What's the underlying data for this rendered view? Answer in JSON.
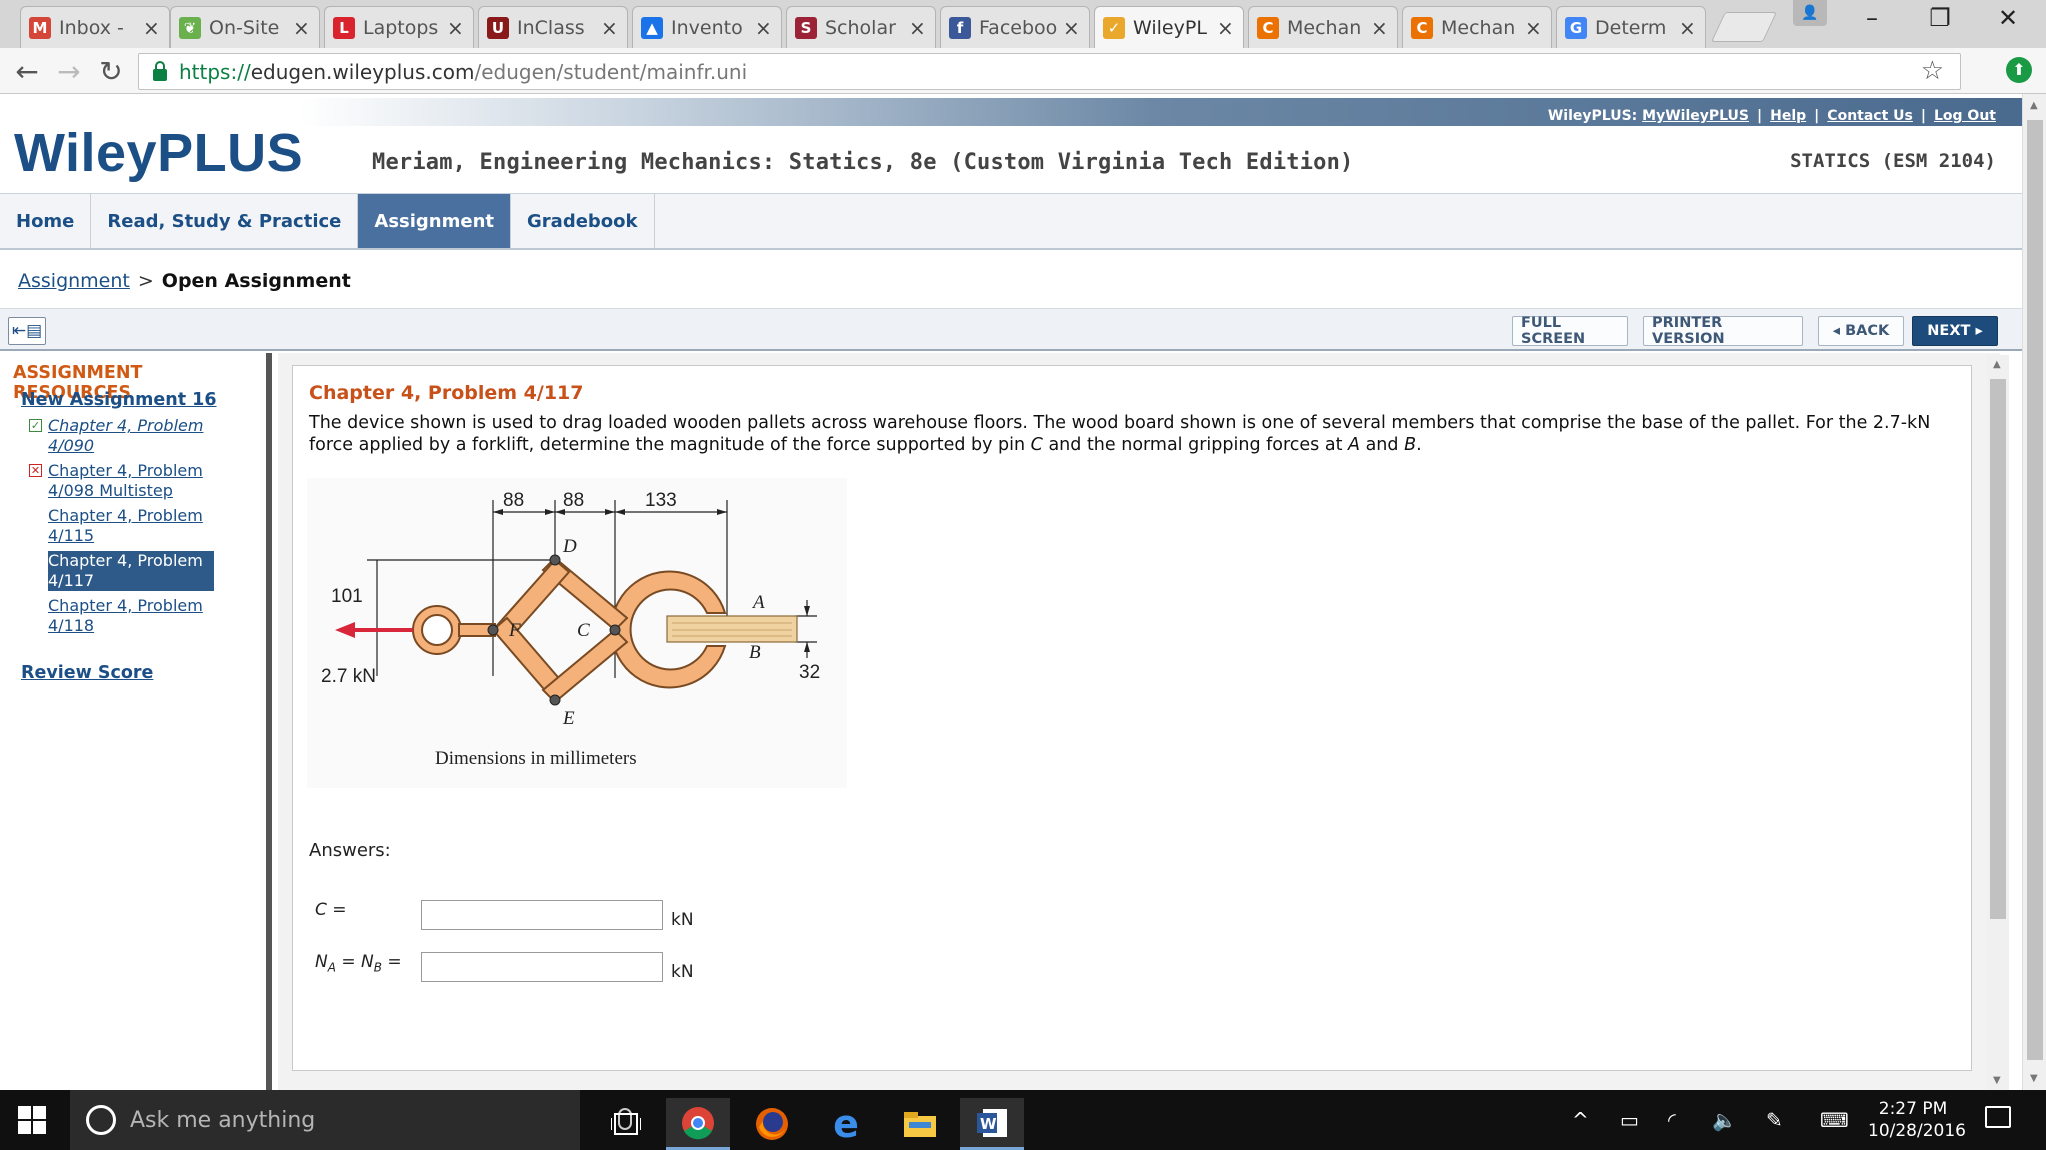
{
  "browser": {
    "tabs": [
      {
        "label": "Inbox -",
        "icon": "gmail-icon",
        "color": "#d44638",
        "glyph": "M"
      },
      {
        "label": "On-Site",
        "icon": "leaf-icon",
        "color": "#6ab04c",
        "glyph": "❦"
      },
      {
        "label": "Laptops",
        "icon": "l-logo-icon",
        "color": "#d9232d",
        "glyph": "L"
      },
      {
        "label": "InClass",
        "icon": "uva-shield-icon",
        "color": "#8a1a1a",
        "glyph": "U"
      },
      {
        "label": "Invento",
        "icon": "triangle-logo-icon",
        "color": "#1a73e8",
        "glyph": "▲"
      },
      {
        "label": "Scholar",
        "icon": "scholar-s-icon",
        "color": "#9b2335",
        "glyph": "S"
      },
      {
        "label": "Faceboo",
        "icon": "facebook-icon",
        "color": "#3b5998",
        "glyph": "f"
      },
      {
        "label": "WileyPL",
        "icon": "wiley-check-icon",
        "color": "#e9a82b",
        "glyph": "✓"
      },
      {
        "label": "Mechan",
        "icon": "chegg-c-icon",
        "color": "#eb7100",
        "glyph": "C"
      },
      {
        "label": "Mechan",
        "icon": "chegg-c-icon",
        "color": "#eb7100",
        "glyph": "C"
      },
      {
        "label": "Determ",
        "icon": "google-icon",
        "color": "#4285f4",
        "glyph": "G"
      }
    ],
    "active_tab_index": 7,
    "url_prefix": "https://",
    "url_domain": "edugen.wileyplus.com",
    "url_path": "/edugen/student/mainfr.uni"
  },
  "header": {
    "brand_prefix": "WileyPLUS:",
    "links": [
      "MyWileyPLUS",
      "Help",
      "Contact Us",
      "Log Out"
    ],
    "logo": "WileyPLUS",
    "book_title": "Meriam, Engineering Mechanics: Statics, 8e (Custom Virginia Tech Edition)",
    "course": "STATICS (ESM 2104)"
  },
  "nav": {
    "items": [
      "Home",
      "Read, Study & Practice",
      "Assignment",
      "Gradebook"
    ],
    "active": "Assignment"
  },
  "breadcrumb": {
    "link": "Assignment",
    "separator": ">",
    "current": "Open Assignment"
  },
  "actions": {
    "full_screen": "FULL SCREEN",
    "printer": "PRINTER VERSION",
    "back": "◂ BACK",
    "next": "NEXT ▸"
  },
  "sidebar": {
    "title": "ASSIGNMENT RESOURCES",
    "assignment": "New Assignment 16",
    "items": [
      {
        "line1": "Chapter 4, Problem",
        "line2": "4/090",
        "status": "correct"
      },
      {
        "line1": "Chapter 4, Problem",
        "line2": "4/098 Multistep",
        "status": "incorrect"
      },
      {
        "line1": "Chapter 4, Problem",
        "line2": "4/115",
        "status": "none"
      },
      {
        "line1": "Chapter 4, Problem",
        "line2": "4/117",
        "status": "current"
      },
      {
        "line1": "Chapter 4, Problem",
        "line2": "4/118",
        "status": "none"
      }
    ],
    "review": "Review Score"
  },
  "problem": {
    "title": "Chapter 4, Problem 4/117",
    "text_1": "The device shown is used to drag loaded wooden pallets across warehouse floors. The wood board shown is one of several members that comprise the base of the pallet. For the 2.7-kN force applied by a forklift, determine the magnitude of the force supported by pin ",
    "text_pin": "C",
    "text_2": " and the normal gripping forces at ",
    "text_a": "A",
    "text_3": " and ",
    "text_b": "B",
    "text_4": ".",
    "figure": {
      "dims_top": [
        "88",
        "88",
        "133"
      ],
      "dim_left": "101",
      "dim_right": "32",
      "force": "2.7 kN",
      "points": [
        "D",
        "F",
        "C",
        "A",
        "B",
        "E"
      ],
      "caption": "Dimensions in millimeters"
    },
    "answers_label": "Answers:",
    "answers": [
      {
        "label": "C =",
        "value": "",
        "unit": "kN"
      },
      {
        "label": "N_A = N_B =",
        "label_html_a": "N",
        "sub_a": "A",
        "eq": " = N",
        "sub_b": "B",
        "value": "",
        "unit": "kN"
      }
    ]
  },
  "taskbar": {
    "search_placeholder": "Ask me anything",
    "time": "2:27 PM",
    "date": "10/28/2016"
  }
}
